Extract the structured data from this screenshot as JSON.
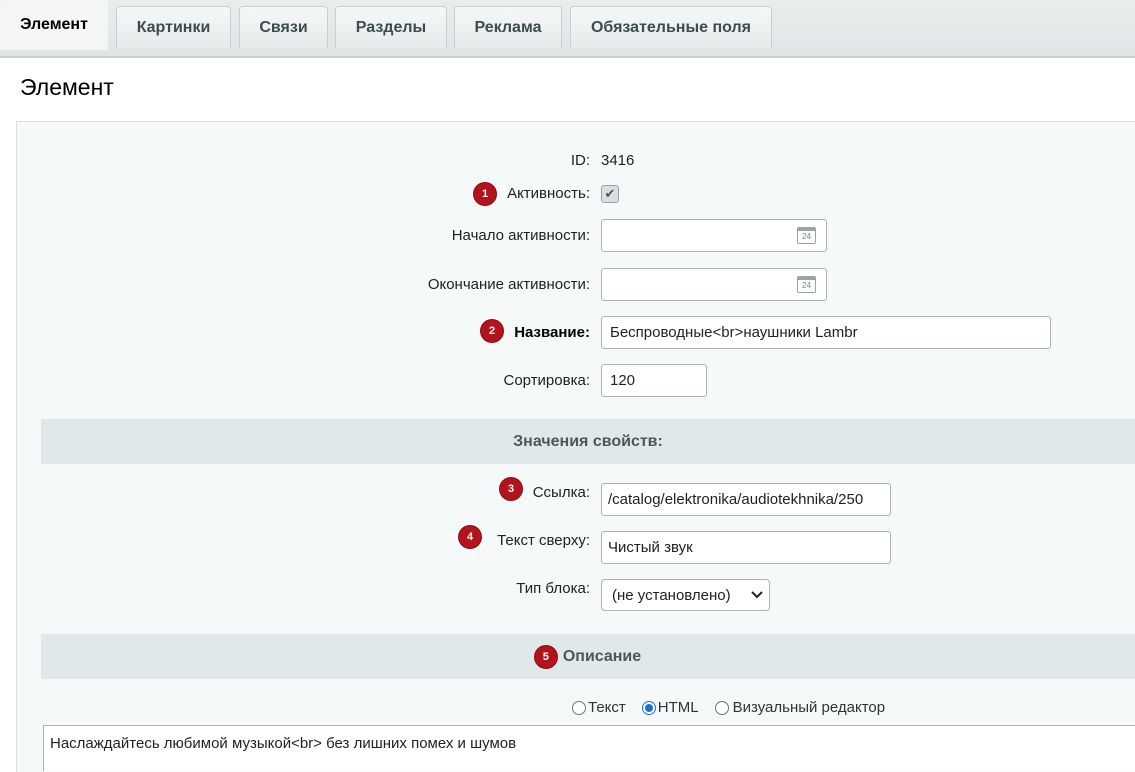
{
  "tabs": [
    {
      "label": "Элемент",
      "active": true
    },
    {
      "label": "Картинки"
    },
    {
      "label": "Связи"
    },
    {
      "label": "Разделы"
    },
    {
      "label": "Реклама"
    },
    {
      "label": "Обязательные поля"
    }
  ],
  "page_title": "Элемент",
  "form": {
    "id_label": "ID:",
    "id_value": "3416",
    "active_label": "Активность:",
    "active_checked": true,
    "active_from_label": "Начало активности:",
    "active_to_label": "Окончание активности:",
    "calendar_icon_text": "24",
    "name_label": "Название:",
    "name_value": "Беспроводные<br>наушники Lambr",
    "sort_label": "Сортировка:",
    "sort_value": "120"
  },
  "properties": {
    "title": "Значения свойств:",
    "link_label": "Ссылка:",
    "link_value": "/catalog/elektronika/audiotekhnika/250",
    "text_top_label": "Текст сверху:",
    "text_top_value": "Чистый звук",
    "block_type_label": "Тип блока:",
    "block_type_value": "(не установлено)"
  },
  "description": {
    "title": "Описание",
    "modes": [
      "Текст",
      "HTML",
      "Визуальный редактор"
    ],
    "selected_mode": "HTML",
    "text": "Наслаждайтесь любимой музыкой<br> без лишних помех и шумов"
  },
  "badges": [
    "1",
    "2",
    "3",
    "4",
    "5"
  ],
  "colors": {
    "badge": "#b3141c",
    "radio_selected": "#1a6fd8",
    "section_bg": "#e0e8ea"
  }
}
